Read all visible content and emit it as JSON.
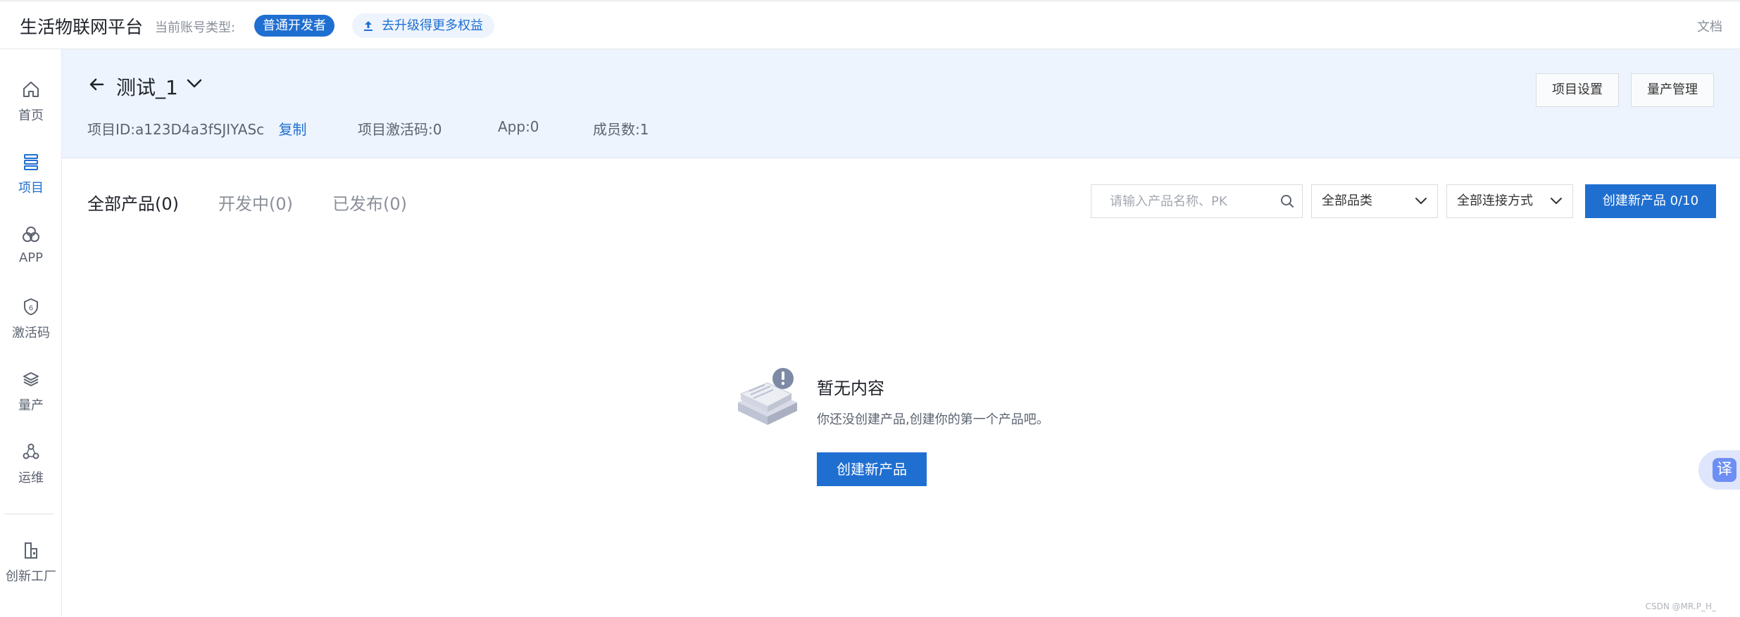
{
  "header": {
    "brand": "生活物联网平台",
    "account_type_label": "当前账号类型:",
    "account_type_badge": "普通开发者",
    "upgrade_label": "去升级得更多权益",
    "docs_link": "文档"
  },
  "sidebar": {
    "items": [
      {
        "label": "首页",
        "icon": "home-icon"
      },
      {
        "label": "项目",
        "icon": "project-icon",
        "active": true
      },
      {
        "label": "APP",
        "icon": "app-icon"
      },
      {
        "label": "激活码",
        "icon": "activation-code-icon"
      },
      {
        "label": "量产",
        "icon": "mass-production-icon"
      },
      {
        "label": "运维",
        "icon": "operations-icon"
      },
      {
        "label": "创新工厂",
        "icon": "innovation-factory-icon"
      }
    ]
  },
  "project": {
    "title": "测试_1",
    "id_label": "项目ID:",
    "id_value": "a123D4a3fSJIYASc",
    "copy_label": "复制",
    "activation_code": "项目激活码:0",
    "app_count": "App:0",
    "member_count": "成员数:1",
    "settings_button": "项目设置",
    "mass_production_button": "量产管理"
  },
  "tabs": [
    {
      "label": "全部产品(0)",
      "active": true
    },
    {
      "label": "开发中(0)",
      "active": false
    },
    {
      "label": "已发布(0)",
      "active": false
    }
  ],
  "filters": {
    "search_placeholder": "请输入产品名称、PK",
    "category_select": "全部品类",
    "connection_select": "全部连接方式",
    "create_button": "创建新产品 0/10"
  },
  "empty_state": {
    "title": "暂无内容",
    "description": "你还没创建产品,创建你的第一个产品吧。",
    "button": "创建新产品"
  },
  "translate_fab": "译",
  "watermark": "CSDN @MR.P_H_",
  "colors": {
    "primary": "#1f6fd1",
    "band_bg": "#eef4fd",
    "muted_text": "#8a8f99"
  }
}
